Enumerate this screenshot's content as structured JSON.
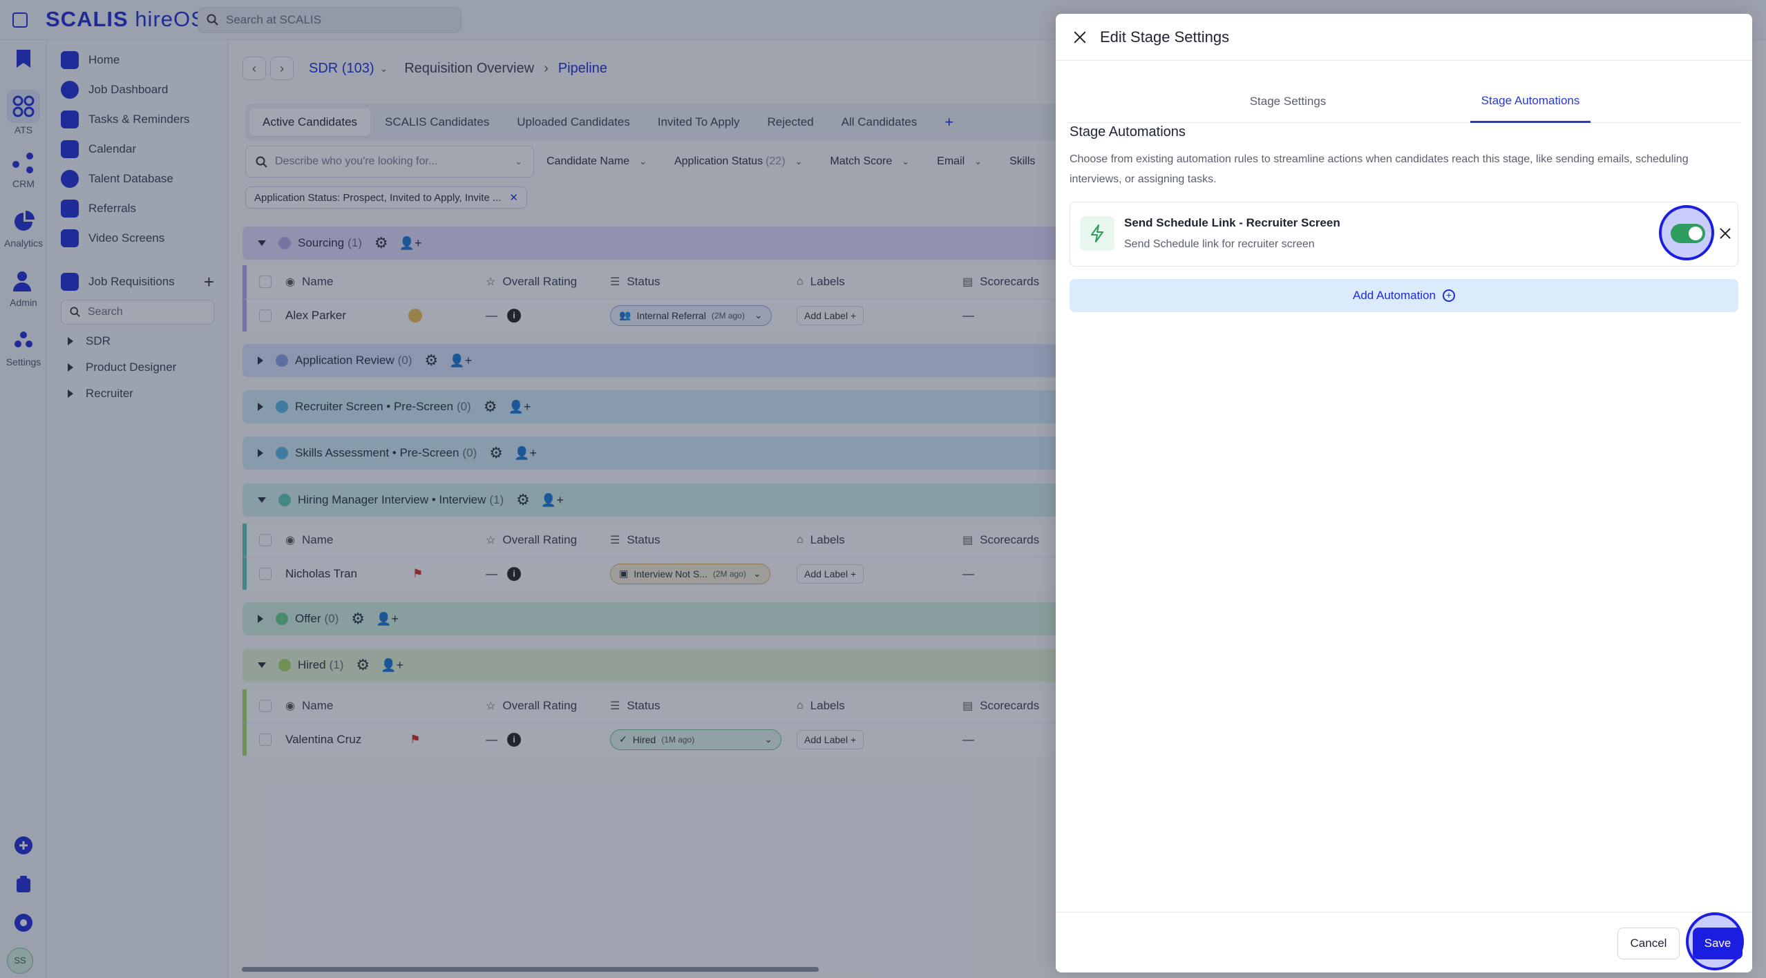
{
  "app": {
    "logo": "SCALIS",
    "logo_suffix": "hireOS",
    "search_placeholder": "Search at SCALIS"
  },
  "rail": {
    "items": [
      {
        "label": "ATS",
        "icon": "ats-icon"
      },
      {
        "label": "CRM",
        "icon": "crm-icon"
      },
      {
        "label": "Analytics",
        "icon": "analytics-icon"
      },
      {
        "label": "Admin",
        "icon": "admin-icon"
      },
      {
        "label": "Settings",
        "icon": "settings-icon"
      }
    ],
    "avatar_initials": "SS"
  },
  "sidebar": {
    "items": [
      {
        "label": "Home"
      },
      {
        "label": "Job Dashboard"
      },
      {
        "label": "Tasks & Reminders"
      },
      {
        "label": "Calendar"
      },
      {
        "label": "Talent Database"
      },
      {
        "label": "Referrals"
      },
      {
        "label": "Video Screens"
      }
    ],
    "job_requisitions": "Job Requisitions",
    "search_placeholder": "Search",
    "tree": [
      "SDR",
      "Product Designer",
      "Recruiter"
    ]
  },
  "breadcrumb": {
    "job": "SDR (103)",
    "section": "Requisition Overview",
    "page": "Pipeline"
  },
  "tabs": [
    "Active Candidates",
    "SCALIS Candidates",
    "Uploaded Candidates",
    "Invited To Apply",
    "Rejected",
    "All Candidates"
  ],
  "filters": {
    "search_placeholder": "Describe who you're looking for...",
    "candidate_name": "Candidate Name",
    "application_status": "Application Status",
    "application_status_count": "(22)",
    "match_score": "Match Score",
    "email": "Email",
    "skills": "Skills"
  },
  "chip": "Application Status: Prospect, Invited to Apply, Invite ...",
  "columns": {
    "name": "Name",
    "rating": "Overall Rating",
    "status": "Status",
    "labels": "Labels",
    "scorecards": "Scorecards"
  },
  "stages": {
    "sourcing": {
      "name": "Sourcing",
      "count": "(1)",
      "color": "#b9a8e6"
    },
    "application_review": {
      "name": "Application Review",
      "count": "(0)",
      "color": "#8aa2e6"
    },
    "recruiter_screen": {
      "name": "Recruiter Screen • Pre-Screen",
      "count": "(0)",
      "color": "#59b3de"
    },
    "skills_assessment": {
      "name": "Skills Assessment • Pre-Screen",
      "count": "(0)",
      "color": "#59b3de"
    },
    "hiring_manager": {
      "name": "Hiring Manager Interview • Interview",
      "count": "(1)",
      "color": "#5cc9b4"
    },
    "offer": {
      "name": "Offer",
      "count": "(0)",
      "color": "#69d08a"
    },
    "hired": {
      "name": "Hired",
      "count": "(1)",
      "color": "#a9d961"
    }
  },
  "rows": {
    "sourcing": {
      "name": "Alex Parker",
      "rating": "—",
      "status": "Internal Referral",
      "status_time": "(2M ago)",
      "add_label": "Add Label",
      "score": "—"
    },
    "hiring_manager": {
      "name": "Nicholas Tran",
      "rating": "—",
      "status": "Interview Not S...",
      "status_time": "(2M ago)",
      "add_label": "Add Label",
      "score": "—"
    },
    "hired": {
      "name": "Valentina Cruz",
      "rating": "—",
      "status": "Hired",
      "status_time": "(1M ago)",
      "add_label": "Add Label",
      "score": "—"
    }
  },
  "drawer": {
    "title": "Edit Stage Settings",
    "tab_settings": "Stage Settings",
    "tab_automations": "Stage Automations",
    "section_title": "Stage Automations",
    "description": "Choose from existing automation rules to streamline actions when candidates reach this stage, like sending emails, scheduling interviews, or assigning tasks.",
    "automation": {
      "title": "Send Schedule Link - Recruiter Screen",
      "subtitle": "Send Schedule link for recruiter screen",
      "enabled": true
    },
    "add_automation": "Add Automation",
    "cancel": "Cancel",
    "save": "Save"
  }
}
